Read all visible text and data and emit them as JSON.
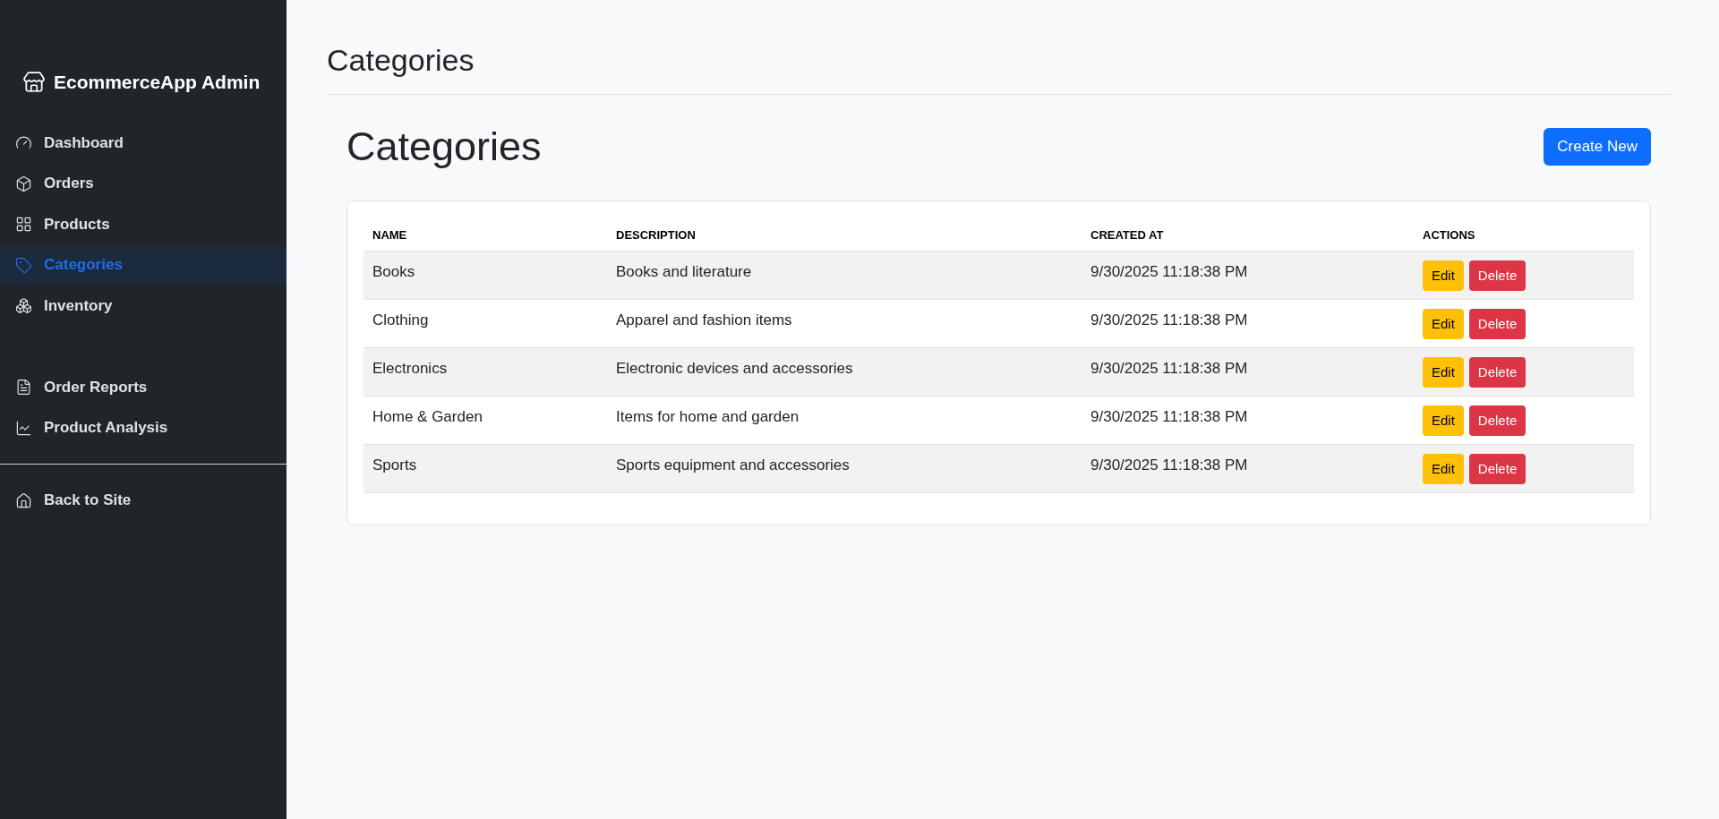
{
  "sidebar": {
    "brand": "EcommerceApp Admin",
    "nav_items": [
      {
        "label": "Dashboard",
        "selected": false
      },
      {
        "label": "Orders",
        "selected": false
      },
      {
        "label": "Products",
        "selected": false
      },
      {
        "label": "Categories",
        "selected": true
      },
      {
        "label": "Inventory",
        "selected": false
      }
    ],
    "report_items": [
      {
        "label": "Order Reports",
        "selected": false
      },
      {
        "label": "Product Analysis",
        "selected": false
      }
    ],
    "footer_items": [
      {
        "label": "Back to Site",
        "selected": false
      }
    ]
  },
  "header": {
    "title": "Categories"
  },
  "page": {
    "heading": "Categories",
    "create_button": "Create New"
  },
  "table": {
    "columns": [
      "NAME",
      "DESCRIPTION",
      "CREATED AT",
      "ACTIONS"
    ],
    "rows": [
      {
        "name": "Books",
        "description": "Books and literature",
        "created_at": "9/30/2025 11:18:38 PM",
        "actions": [
          {
            "kind": "edit",
            "label": "Edit"
          },
          {
            "kind": "delete",
            "label": "Delete"
          }
        ]
      },
      {
        "name": "Clothing",
        "description": "Apparel and fashion items",
        "created_at": "9/30/2025 11:18:38 PM",
        "actions": [
          {
            "kind": "edit",
            "label": "Edit"
          },
          {
            "kind": "delete",
            "label": "Delete"
          }
        ]
      },
      {
        "name": "Electronics",
        "description": "Electronic devices and accessories",
        "created_at": "9/30/2025 11:18:38 PM",
        "actions": [
          {
            "kind": "edit",
            "label": "Edit"
          },
          {
            "kind": "delete",
            "label": "Delete"
          }
        ]
      },
      {
        "name": "Home & Garden",
        "description": "Items for home and garden",
        "created_at": "9/30/2025 11:18:38 PM",
        "actions": [
          {
            "kind": "edit",
            "label": "Edit"
          },
          {
            "kind": "delete",
            "label": "Delete"
          }
        ]
      },
      {
        "name": "Sports",
        "description": "Sports equipment and accessories",
        "created_at": "9/30/2025 11:18:38 PM",
        "actions": [
          {
            "kind": "edit",
            "label": "Edit"
          },
          {
            "kind": "delete",
            "label": "Delete"
          }
        ]
      }
    ]
  }
}
